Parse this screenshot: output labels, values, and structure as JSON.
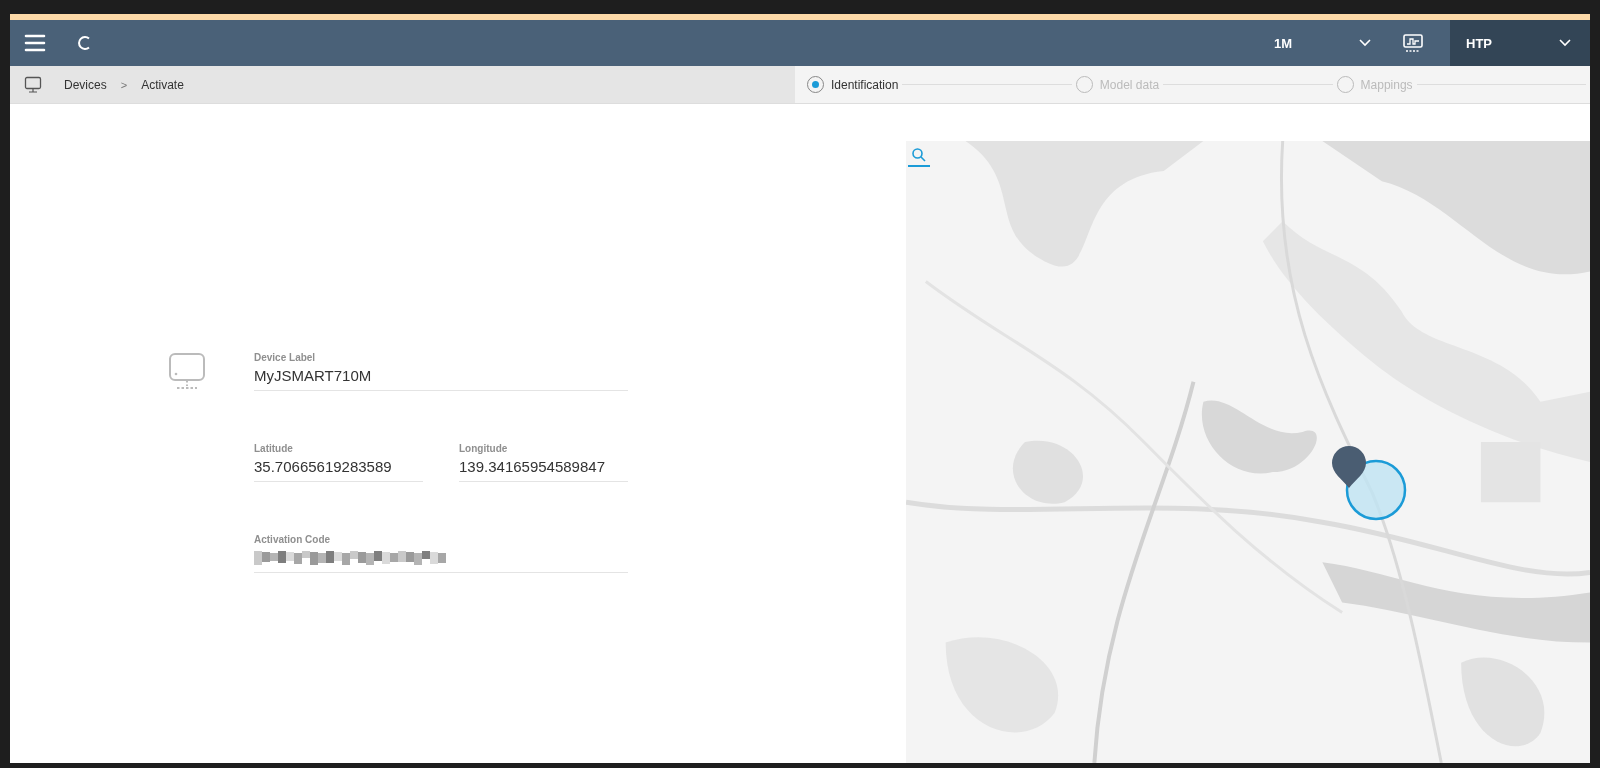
{
  "header": {
    "interval": "1M",
    "tenant": "HTP"
  },
  "breadcrumb": [
    "Devices",
    "Activate"
  ],
  "breadcrumb_separator": ">",
  "steps": [
    {
      "label": "Identification",
      "selected": true
    },
    {
      "label": "Model data",
      "selected": false
    },
    {
      "label": "Mappings",
      "selected": false
    }
  ],
  "form": {
    "device_label": {
      "label": "Device Label",
      "value": "MyJSMART710M"
    },
    "latitude": {
      "label": "Latitude",
      "value": "35.70665619283589"
    },
    "longitude": {
      "label": "Longitude",
      "value": "139.34165954589847"
    },
    "activation_code": {
      "label": "Activation Code",
      "redacted": true
    }
  },
  "map": {
    "kind": "picture",
    "marker": true
  }
}
